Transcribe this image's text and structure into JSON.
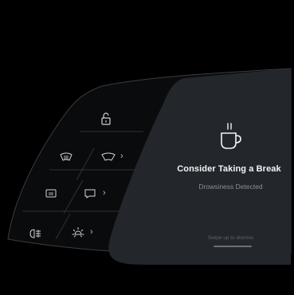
{
  "alert": {
    "title": "Consider Taking a Break",
    "subtitle": "Drowsiness Detected",
    "dismiss_hint": "Swipe up to dismiss",
    "icon": "coffee-cup-icon"
  },
  "controls": [
    {
      "name": "unlock-icon"
    },
    {
      "name": "rear-defrost-icon"
    },
    {
      "name": "front-defrost-icon"
    },
    {
      "name": "seat-heater-icon"
    },
    {
      "name": "mirror-icon"
    },
    {
      "name": "fog-light-icon"
    },
    {
      "name": "brightness-icon"
    }
  ],
  "colors": {
    "background": "#000000",
    "panel": "#1b1d21",
    "card": "#272a30",
    "outline": "#3a3d42"
  }
}
